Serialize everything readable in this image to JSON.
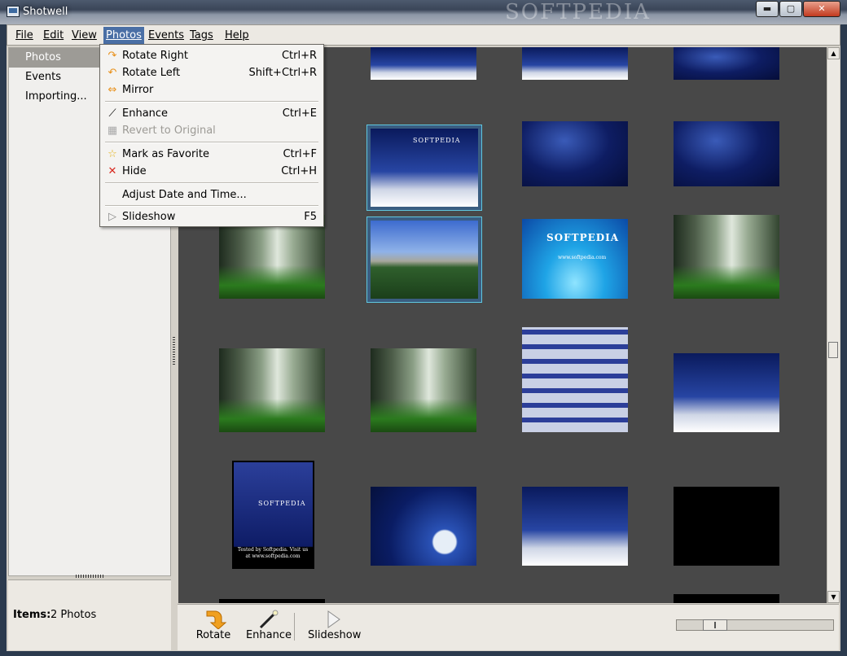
{
  "window": {
    "title": "Shotwell",
    "watermark": "SOFTPEDIA"
  },
  "window_controls": {
    "minimize": "▬",
    "maximize": "▢",
    "close": "✕"
  },
  "menubar": [
    "File",
    "Edit",
    "View",
    "Photos",
    "Events",
    "Tags",
    "Help"
  ],
  "active_menu": "Photos",
  "photos_menu": {
    "rotate_right": {
      "label": "Rotate Right",
      "shortcut": "Ctrl+R"
    },
    "rotate_left": {
      "label": "Rotate Left",
      "shortcut": "Shift+Ctrl+R"
    },
    "mirror": {
      "label": "Mirror",
      "shortcut": ""
    },
    "enhance": {
      "label": "Enhance",
      "shortcut": "Ctrl+E"
    },
    "revert": {
      "label": "Revert to Original",
      "shortcut": "",
      "disabled": true
    },
    "favorite": {
      "label": "Mark as Favorite",
      "shortcut": "Ctrl+F"
    },
    "hide": {
      "label": "Hide",
      "shortcut": "Ctrl+H"
    },
    "adjust_date": {
      "label": "Adjust Date and Time...",
      "shortcut": ""
    },
    "slideshow": {
      "label": "Slideshow",
      "shortcut": "F5"
    }
  },
  "sidebar": {
    "items": [
      {
        "label": "Photos",
        "selected": true
      },
      {
        "label": "Events",
        "selected": false
      },
      {
        "label": "Importing...",
        "selected": false
      }
    ]
  },
  "status": {
    "items_label": "Items:",
    "items_value": "2 Photos"
  },
  "thumbnails": {
    "softpedia_label": "SOFTPEDIA",
    "softpedia_url": "www.softpedia.com",
    "poster_caption": "Tested by Softpedia. Visit us at www.softpedia.com"
  },
  "toolbar": {
    "rotate_label": "Rotate",
    "enhance_label": "Enhance",
    "slideshow_label": "Slideshow"
  },
  "colors": {
    "selection": "#5fc7df",
    "menu_highlight": "#4a6fa5",
    "photo_bg": "#484848"
  }
}
